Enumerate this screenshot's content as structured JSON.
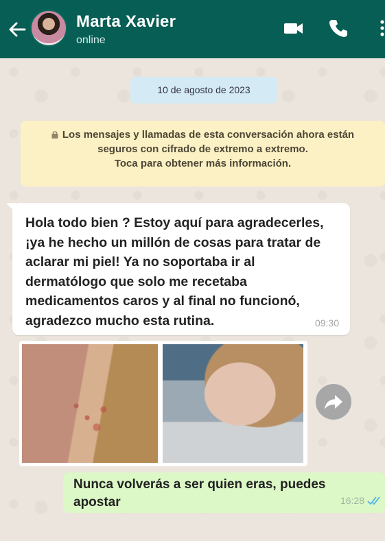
{
  "header": {
    "contact_name": "Marta Xavier",
    "status": "online",
    "icons": [
      "back-arrow-icon",
      "video-call-icon",
      "phone-icon",
      "more-options-icon"
    ]
  },
  "chat": {
    "date": "10 de agosto de 2023",
    "encryption_notice": {
      "line1": "Los mensajes y llamadas de esta conversación ahora están",
      "line2": "seguros con cifrado de extremo a extremo.",
      "line3": "Toca para obtener más información."
    },
    "messages": [
      {
        "direction": "incoming",
        "text": "Hola todo bien ? Estoy aquí para agradecerles, ¡ya he hecho un millón de cosas para tratar de aclarar mi piel! Ya no soportaba ir al dermatólogo que solo me recetaba medicamentos caros y al final no funcionó, agradezco mucho esta rutina.",
        "time": "09:30"
      },
      {
        "direction": "incoming",
        "type": "images",
        "count": 2
      },
      {
        "direction": "outgoing",
        "text": "Nunca volverás a ser quien eras, puedes apostar",
        "time": "16:28",
        "status": "read"
      }
    ]
  },
  "colors": {
    "header": "#075e54",
    "outgoing_bubble": "#dcf8c6",
    "incoming_bubble": "#ffffff",
    "notice": "#fcf1c4",
    "date_pill": "#d4eaf4",
    "read_ticks": "#4fb6ec"
  }
}
